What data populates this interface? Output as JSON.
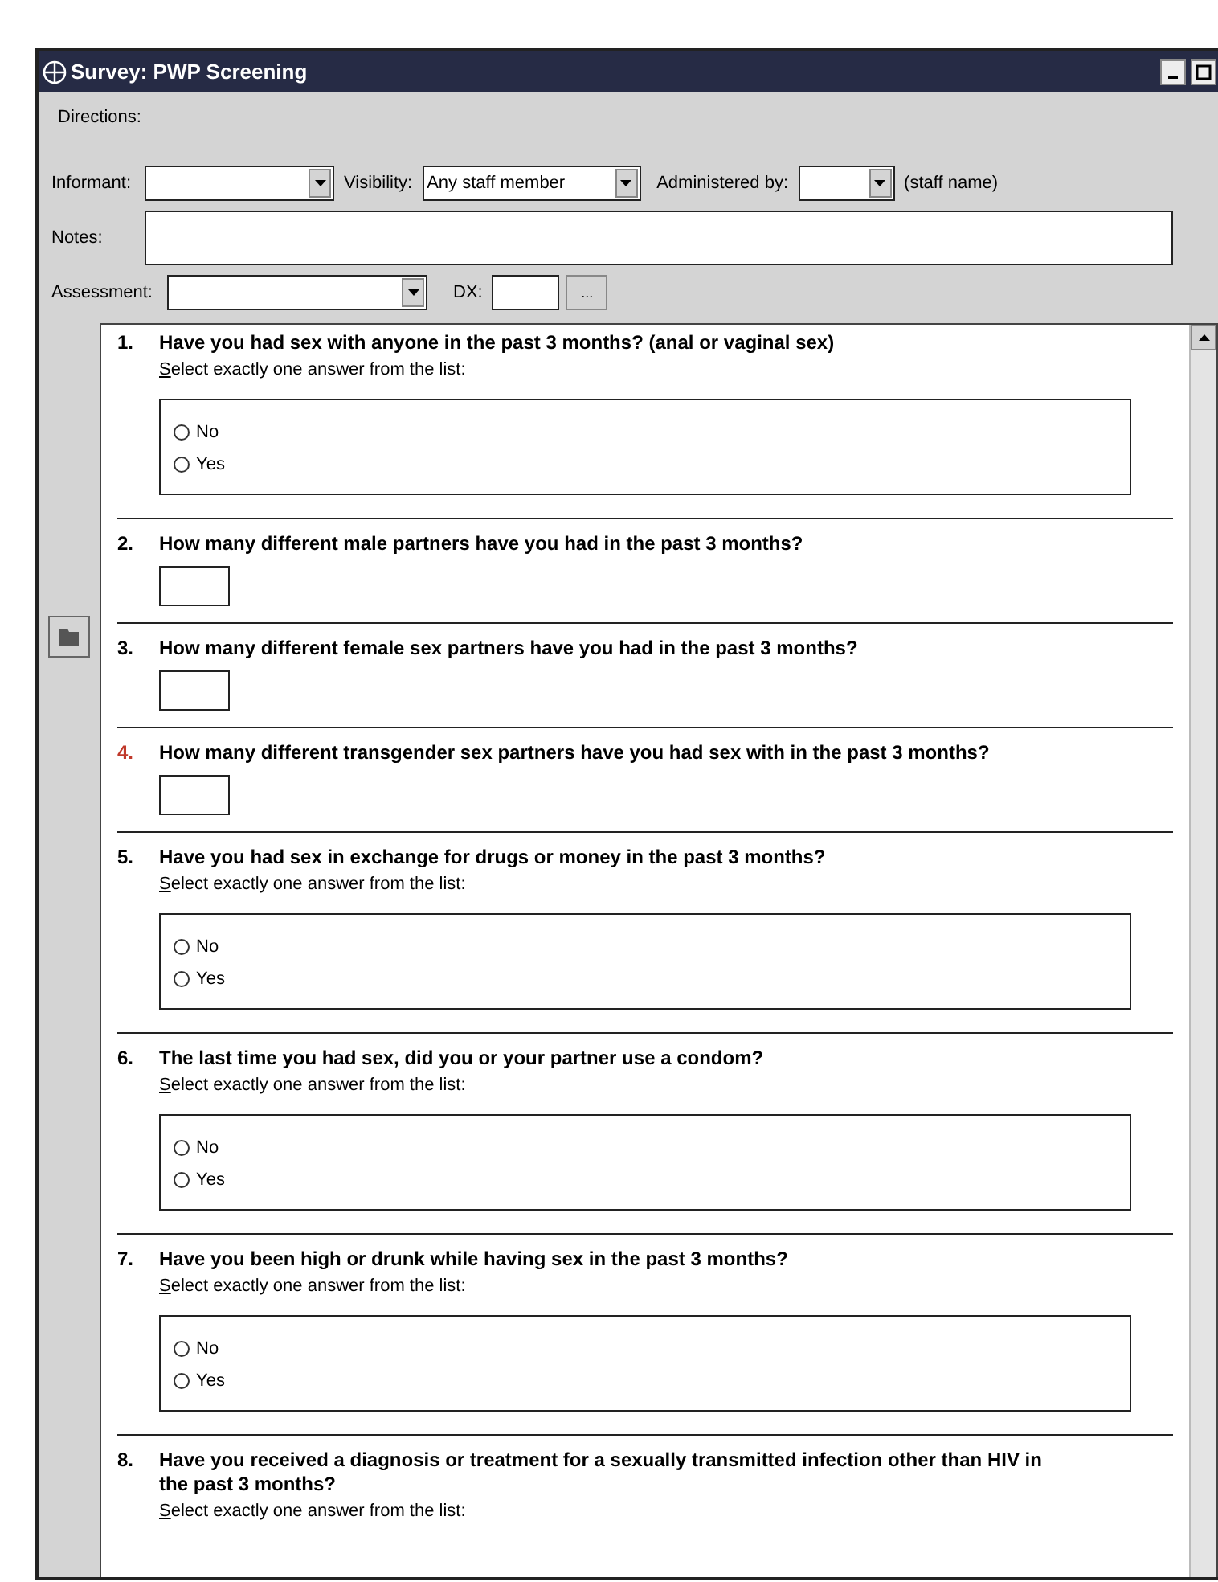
{
  "window": {
    "title": "Survey: PWP Screening"
  },
  "directions_label": "Directions:",
  "header": {
    "informant": {
      "label": "Informant:"
    },
    "visibility": {
      "label": "Visibility:",
      "value": "Any staff member"
    },
    "administered_by": {
      "label": "Administered by:",
      "suffix": "(staff name)"
    },
    "notes": {
      "label": "Notes:"
    },
    "assessment": {
      "label": "Assessment:"
    },
    "dx": {
      "label": "DX:",
      "button": "..."
    }
  },
  "questions": [
    {
      "number": "1.",
      "text": "Have you had sex with anyone in the past 3 months? (anal or vaginal sex)",
      "kind": "choice",
      "flagged": false,
      "hint": "Select exactly one answer from the list:",
      "options": [
        {
          "label": "No",
          "selected": false
        },
        {
          "label": "Yes",
          "selected": false
        }
      ]
    },
    {
      "number": "2.",
      "text": "How many different male partners have you had in the past 3 months?",
      "kind": "number",
      "flagged": false
    },
    {
      "number": "3.",
      "text": "How many different female sex partners have you had in the past 3 months?",
      "kind": "number",
      "flagged": false
    },
    {
      "number": "4.",
      "text": "How many different transgender sex partners have you had sex with in the past 3 months?",
      "kind": "number",
      "flagged": true
    },
    {
      "number": "5.",
      "text": "Have you had sex in exchange for drugs or money in the past 3 months?",
      "kind": "choice",
      "flagged": false,
      "hint": "Select exactly one answer from the list:",
      "options": [
        {
          "label": "No",
          "selected": false
        },
        {
          "label": "Yes",
          "selected": false
        }
      ]
    },
    {
      "number": "6.",
      "text": "The last time you had sex, did you or your partner use a condom?",
      "kind": "choice",
      "flagged": false,
      "hint": "Select exactly one answer from the list:",
      "options": [
        {
          "label": "No",
          "selected": false
        },
        {
          "label": "Yes",
          "selected": false
        }
      ]
    },
    {
      "number": "7.",
      "text": "Have you been high or drunk while having sex in the past 3 months?",
      "kind": "choice",
      "flagged": false,
      "hint": "Select exactly one answer from the list:",
      "options": [
        {
          "label": "No",
          "selected": false
        },
        {
          "label": "Yes",
          "selected": false
        }
      ]
    },
    {
      "number": "8.",
      "text": "Have you received a diagnosis or treatment for a sexually transmitted infection other than HIV in the past 3 months?",
      "kind": "header_only",
      "flagged": false,
      "hint": "Select exactly one answer from the list:"
    }
  ]
}
